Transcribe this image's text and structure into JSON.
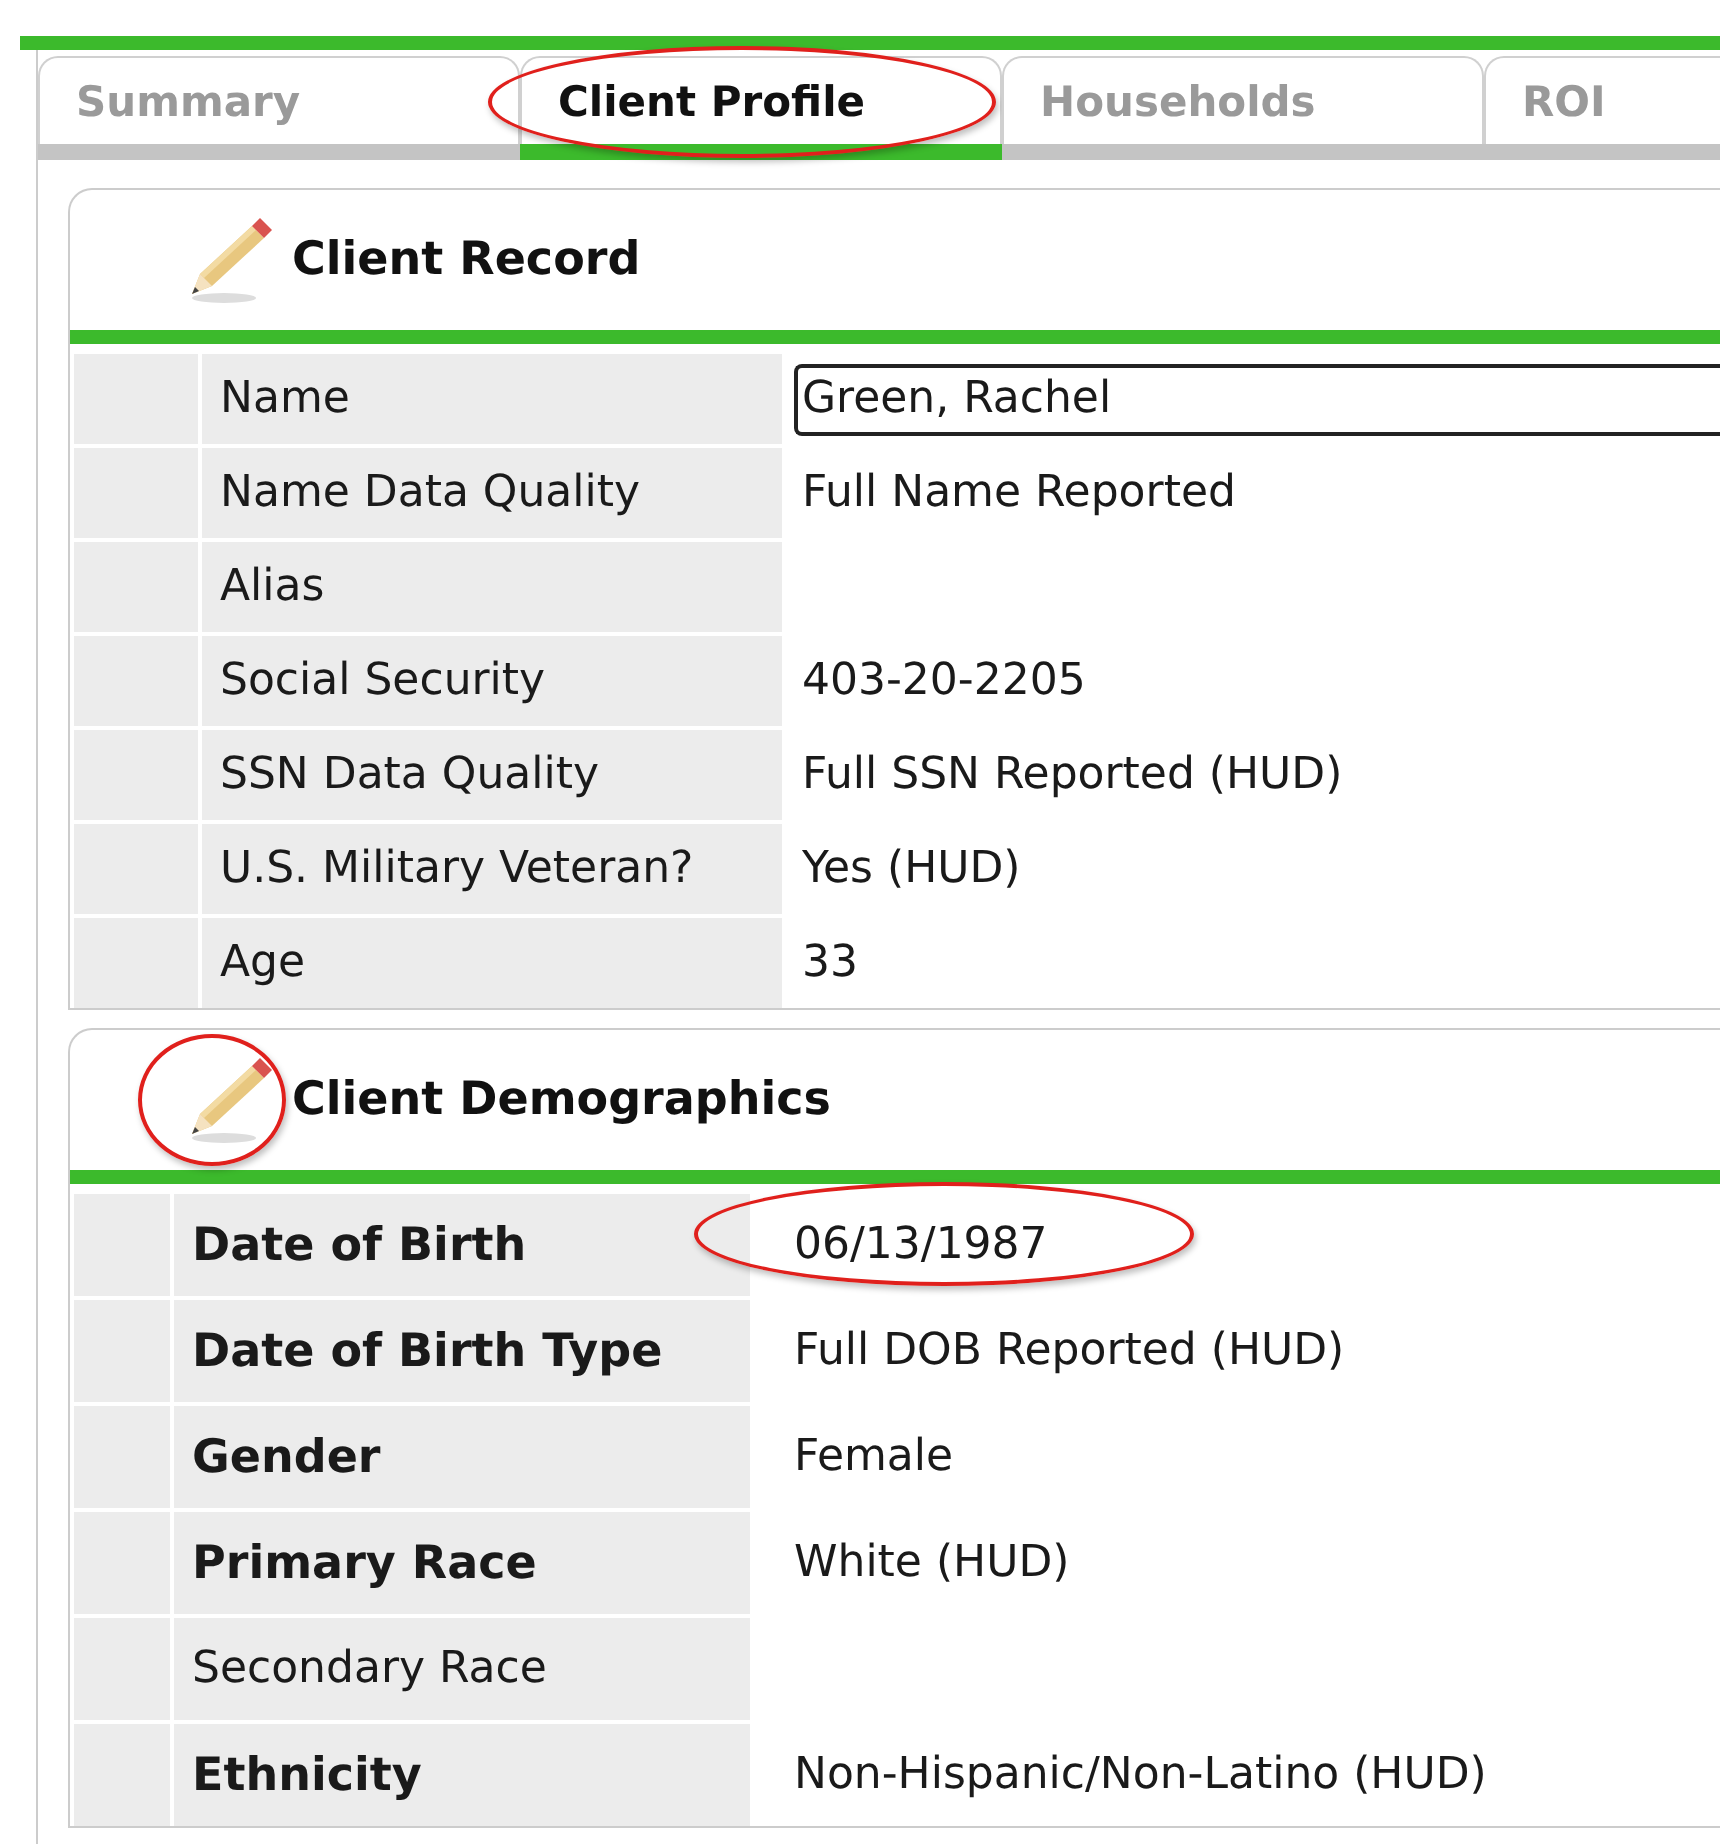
{
  "tabs": [
    {
      "label": "Summary",
      "selected": false,
      "annotated": false
    },
    {
      "label": "Client Profile",
      "selected": true,
      "annotated": true
    },
    {
      "label": "Households",
      "selected": false,
      "annotated": false
    },
    {
      "label": "ROI",
      "selected": false,
      "annotated": false
    }
  ],
  "sections": [
    {
      "title": "Client Record",
      "icon_annotated": false,
      "kind": "record",
      "rows": [
        {
          "label": "Name",
          "value": "Green, Rachel",
          "kind": "input",
          "bold": false,
          "annotated": false
        },
        {
          "label": "Name Data Quality",
          "value": "Full Name Reported",
          "kind": "text",
          "bold": false,
          "annotated": false
        },
        {
          "label": "Alias",
          "kind": "text",
          "bold": false,
          "annotated": false
        },
        {
          "label": "Social Security",
          "value": "403-20-2205",
          "kind": "text",
          "bold": false,
          "annotated": false
        },
        {
          "label": "SSN Data Quality",
          "value": "Full SSN Reported (HUD)",
          "kind": "text",
          "bold": false,
          "annotated": false
        },
        {
          "label": "U.S. Military Veteran?",
          "value": "Yes (HUD)",
          "kind": "text",
          "bold": false,
          "annotated": false
        },
        {
          "label": "Age",
          "value": "33",
          "kind": "text",
          "bold": false,
          "annotated": false
        }
      ]
    },
    {
      "title": "Client Demographics",
      "icon_annotated": true,
      "kind": "demographics",
      "rows": [
        {
          "label": "Date of Birth",
          "value": "06/13/1987",
          "kind": "text",
          "bold": true,
          "annotated": true
        },
        {
          "label": "Date of Birth Type",
          "value": "Full DOB Reported (HUD)",
          "kind": "text",
          "bold": true,
          "annotated": false
        },
        {
          "label": "Gender",
          "value": "Female",
          "kind": "text",
          "bold": true,
          "annotated": false
        },
        {
          "label": "Primary Race",
          "value": "White (HUD)",
          "kind": "text",
          "bold": true,
          "annotated": false
        },
        {
          "label": "Secondary Race",
          "kind": "text",
          "bold": false,
          "annotated": false
        },
        {
          "label": "Ethnicity",
          "value": "Non-Hispanic/Non-Latino (HUD)",
          "kind": "text",
          "bold": true,
          "annotated": false
        }
      ]
    }
  ]
}
